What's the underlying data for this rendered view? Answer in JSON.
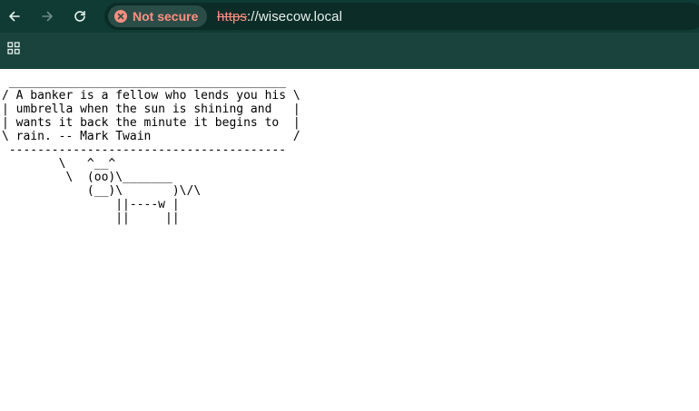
{
  "browser": {
    "nav": {
      "back_icon": "arrow-left-icon",
      "forward_icon": "arrow-right-icon",
      "reload_icon": "reload-icon"
    },
    "omnibox": {
      "security_label": "Not secure",
      "security_icon": "warning-circle-icon",
      "url_scheme": "https",
      "url_rest": "://wisecow.local"
    },
    "bookmarks_bar": {
      "apps_icon": "apps-grid-icon"
    },
    "colors": {
      "toolbar": "#0f3b34",
      "bookmarks_bar": "#1b433d",
      "warning": "#ff8f80"
    }
  },
  "page": {
    "cowsay_text": " _______________________________________\n/ A banker is a fellow who lends you his \\\n| umbrella when the sun is shining and   |\n| wants it back the minute it begins to  |\n\\ rain. -- Mark Twain                    /\n ---------------------------------------\n        \\   ^__^\n         \\  (oo)\\_______\n            (__)\\       )\\/\\\n                ||----w |\n                ||     ||"
  }
}
